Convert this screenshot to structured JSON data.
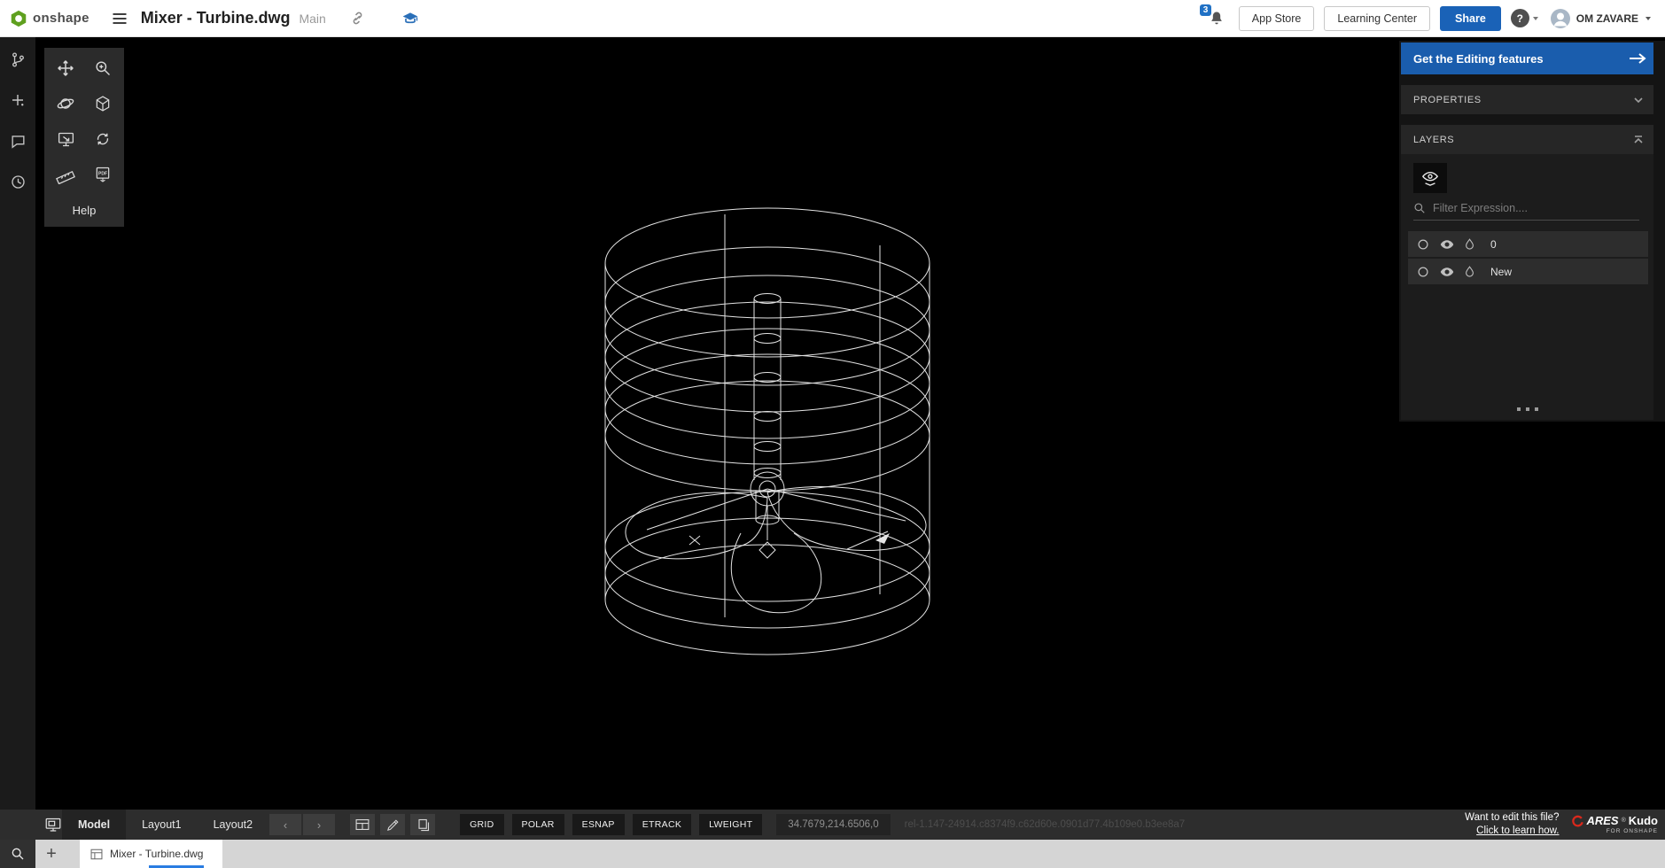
{
  "header": {
    "logo_text": "onshape",
    "document_title": "Mixer - Turbine.dwg",
    "workspace_label": "Main",
    "notifications_badge": "3",
    "app_store_label": "App Store",
    "learning_center_label": "Learning Center",
    "share_label": "Share",
    "help_label": "?",
    "user_name": "OM ZAVARE"
  },
  "view_toolbar": {
    "help_label": "Help"
  },
  "right_panel": {
    "editing_banner_label": "Get the Editing features",
    "properties_header": "PROPERTIES",
    "layers_header": "LAYERS",
    "filter_placeholder": "Filter Expression....",
    "layers": [
      {
        "name": "0"
      },
      {
        "name": "New"
      }
    ]
  },
  "status_bar": {
    "sheet_tabs": [
      "Model",
      "Layout1",
      "Layout2"
    ],
    "toggles": [
      "GRID",
      "POLAR",
      "ESNAP",
      "ETRACK",
      "LWEIGHT"
    ],
    "coordinates": "34.7679,214.6506,0",
    "build_id": "rel-1.147-24914.c8374f9.c62d60e.0901d77.4b109e0.b3ee8a7",
    "edit_prompt": "Want to edit this file?",
    "edit_link_label": "Click to learn how.",
    "brand_name": "ARES",
    "brand_reg": "®",
    "brand_product": "Kudo",
    "brand_sub": "FOR ONSHAPE",
    "nav_prev": "‹",
    "nav_next": "›",
    "plus_label": "+"
  },
  "file_tab_bar": {
    "active_tab_label": "Mixer - Turbine.dwg"
  },
  "colors": {
    "accent_blue": "#1a62b7",
    "banner_blue": "#1a5dad",
    "wireframe": "#e3e3e3"
  }
}
